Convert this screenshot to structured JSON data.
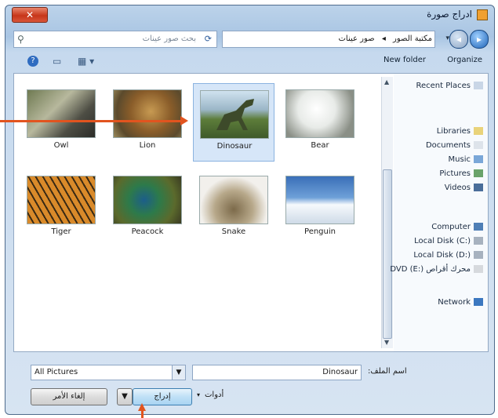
{
  "window": {
    "title": "ادراج صورة"
  },
  "search": {
    "placeholder": "بحث صور عينات"
  },
  "address": {
    "crumbs": [
      "مكتبة الصور",
      "صور عينات"
    ]
  },
  "toolbar": {
    "organize_label": "Organize",
    "newfolder_label": "New folder"
  },
  "files": [
    {
      "label": "Owl",
      "selected": false
    },
    {
      "label": "Lion",
      "selected": false
    },
    {
      "label": "Dinosaur",
      "selected": true
    },
    {
      "label": "Bear",
      "selected": false
    },
    {
      "label": "Tiger",
      "selected": false
    },
    {
      "label": "Peacock",
      "selected": false
    },
    {
      "label": "Snake",
      "selected": false
    },
    {
      "label": "Penguin",
      "selected": false
    }
  ],
  "navpane": {
    "items": [
      "Recent Places",
      "Libraries",
      "Documents",
      "Music",
      "Pictures",
      "Videos",
      "Computer",
      "Local Disk (C:)",
      "Local Disk (D:)",
      "محرك أقراص DVD (E:)",
      "Network"
    ]
  },
  "footer": {
    "filename_label": "اسم الملف:",
    "filename_value": "Dinosaur",
    "filetype_value": "All Pictures",
    "insert_label": "إدراج",
    "cancel_label": "إلغاء الأمر",
    "tools_label": "أدوات"
  }
}
